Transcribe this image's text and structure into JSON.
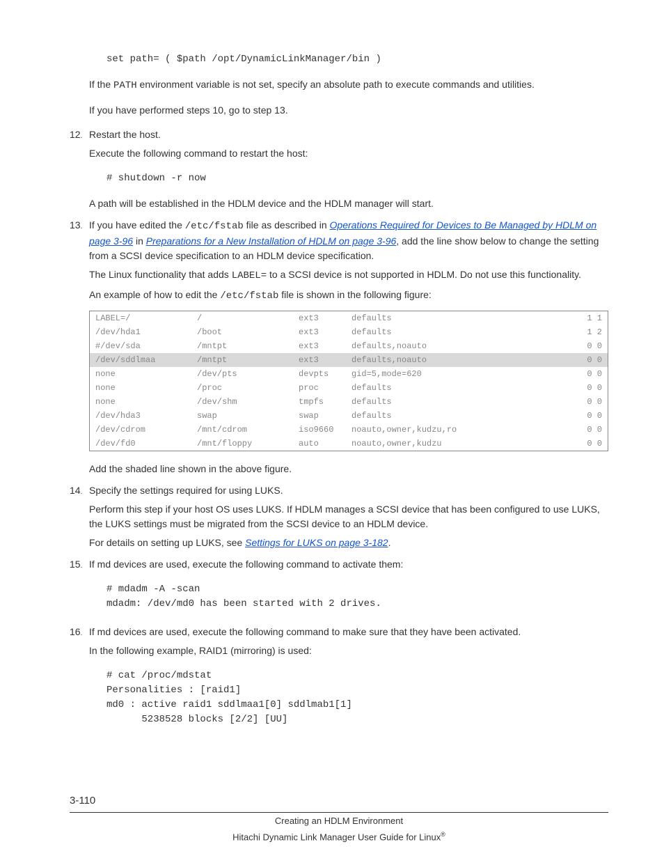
{
  "pre_code": "set path= ( $path /opt/DynamicLinkManager/bin )",
  "pre_text1_a": "If the ",
  "pre_text1_code": "PATH",
  "pre_text1_b": " environment variable is not set, specify an absolute path to execute commands and utilities.",
  "pre_text2": "If you have performed steps 10, go to step 13.",
  "s12": {
    "num": "12",
    "title": "Restart the host.",
    "p1": "Execute the following command to restart the host:",
    "code": "# shutdown -r now",
    "p2": "A path will be established in the HDLM device and the HDLM manager will start."
  },
  "s13": {
    "num": "13",
    "intro_a": "If you have edited the ",
    "intro_code": "/etc/fstab",
    "intro_b": " file as described in ",
    "link1": "Operations Required for Devices to Be Managed by HDLM on page 3-96",
    "intro_c": " in ",
    "link2": "Preparations for a New Installation of HDLM on page 3-96",
    "intro_d": ", add the line show below to change the setting from a SCSI device specification to an HDLM device specification.",
    "p2_a": "The Linux functionality that adds ",
    "p2_code": "LABEL=",
    "p2_b": " to a SCSI device is not supported in HDLM. Do not use this functionality.",
    "p3_a": "An example of how to edit the ",
    "p3_code": "/etc/fstab",
    "p3_b": " file is shown in the following figure:",
    "table": [
      {
        "d": "LABEL=/",
        "m": "/",
        "f": "ext3",
        "o": "defaults",
        "n": "1 1",
        "hl": false
      },
      {
        "d": "/dev/hda1",
        "m": "/boot",
        "f": "ext3",
        "o": "defaults",
        "n": "1 2",
        "hl": false
      },
      {
        "d": "#/dev/sda",
        "m": "/mntpt",
        "f": "ext3",
        "o": "defaults,noauto",
        "n": "0 0",
        "hl": false
      },
      {
        "d": "/dev/sddlmaa",
        "m": "/mntpt",
        "f": "ext3",
        "o": "defaults,noauto",
        "n": "0 0",
        "hl": true
      },
      {
        "d": "none",
        "m": "/dev/pts",
        "f": "devpts",
        "o": "gid=5,mode=620",
        "n": "0 0",
        "hl": false
      },
      {
        "d": "none",
        "m": "/proc",
        "f": "proc",
        "o": "defaults",
        "n": "0 0",
        "hl": false
      },
      {
        "d": "none",
        "m": "/dev/shm",
        "f": "tmpfs",
        "o": "defaults",
        "n": "0 0",
        "hl": false
      },
      {
        "d": "/dev/hda3",
        "m": "swap",
        "f": "swap",
        "o": "defaults",
        "n": "0 0",
        "hl": false
      },
      {
        "d": "/dev/cdrom",
        "m": "/mnt/cdrom",
        "f": "iso9660",
        "o": "noauto,owner,kudzu,ro",
        "n": "0 0",
        "hl": false
      },
      {
        "d": "/dev/fd0",
        "m": "/mnt/floppy",
        "f": "auto",
        "o": "noauto,owner,kudzu",
        "n": "0 0",
        "hl": false
      }
    ],
    "after": "Add the shaded line shown in the above figure."
  },
  "s14": {
    "num": "14",
    "title": "Specify the settings required for using LUKS.",
    "p1": "Perform this step if your host OS uses LUKS. If HDLM manages a SCSI device that has been configured to use LUKS, the LUKS settings must be migrated from the SCSI device to an HDLM device.",
    "p2_a": "For details on setting up LUKS, see ",
    "link": "Settings for LUKS on page 3-182",
    "p2_b": "."
  },
  "s15": {
    "num": "15",
    "title": "If md devices are used, execute the following command to activate them:",
    "code": "# mdadm -A -scan\nmdadm: /dev/md0 has been started with 2 drives."
  },
  "s16": {
    "num": "16",
    "title": "If md devices are used, execute the following command to make sure that they have been activated.",
    "p1": "In the following example, RAID1 (mirroring) is used:",
    "code": "# cat /proc/mdstat\nPersonalities : [raid1]\nmd0 : active raid1 sddlmaa1[0] sddlmab1[1]\n      5238528 blocks [2/2] [UU]"
  },
  "footer": {
    "page": "3-110",
    "line1": "Creating an HDLM Environment",
    "line2": "Hitachi Dynamic Link Manager User Guide for Linux"
  }
}
